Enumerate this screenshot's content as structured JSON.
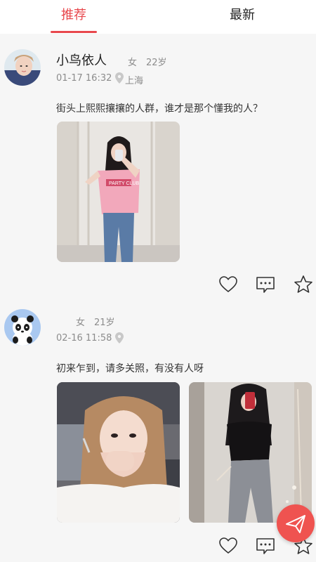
{
  "tabs": {
    "recommended": "推荐",
    "latest": "最新"
  },
  "posts": [
    {
      "username": "小鸟依人",
      "gender": "女",
      "age": "22岁",
      "time": "01-17 16:32",
      "location": "上海",
      "text": "街头上熙熙攘攘的人群，谁才是那个懂我的人？",
      "shirt_text": "PARTY CLUB"
    },
    {
      "username": "",
      "gender": "女",
      "age": "21岁",
      "time": "02-16 11:58",
      "location": "",
      "text": "初来乍到，请多关照，有没有人呀"
    }
  ],
  "colors": {
    "accent": "#e8484d",
    "fab": "#ef5350"
  },
  "icons": [
    "heart-icon",
    "comment-icon",
    "star-icon",
    "send-icon",
    "location-pin-icon"
  ]
}
